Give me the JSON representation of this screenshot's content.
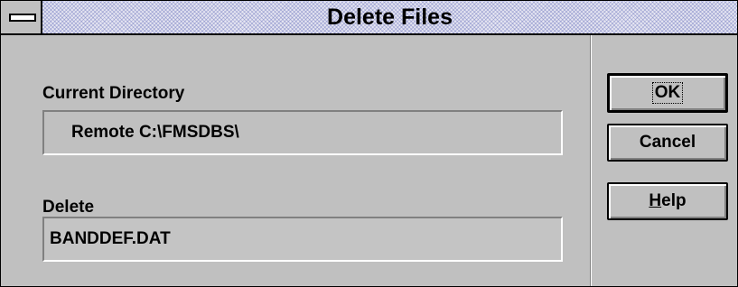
{
  "window": {
    "title": "Delete Files"
  },
  "current_directory": {
    "label": "Current Directory",
    "value": "Remote C:\\FMSDBS\\"
  },
  "delete": {
    "label": "Delete",
    "value": "BANDDEF.DAT"
  },
  "buttons": {
    "ok": "OK",
    "cancel": "Cancel",
    "help_prefix": "H",
    "help_rest": "elp"
  }
}
